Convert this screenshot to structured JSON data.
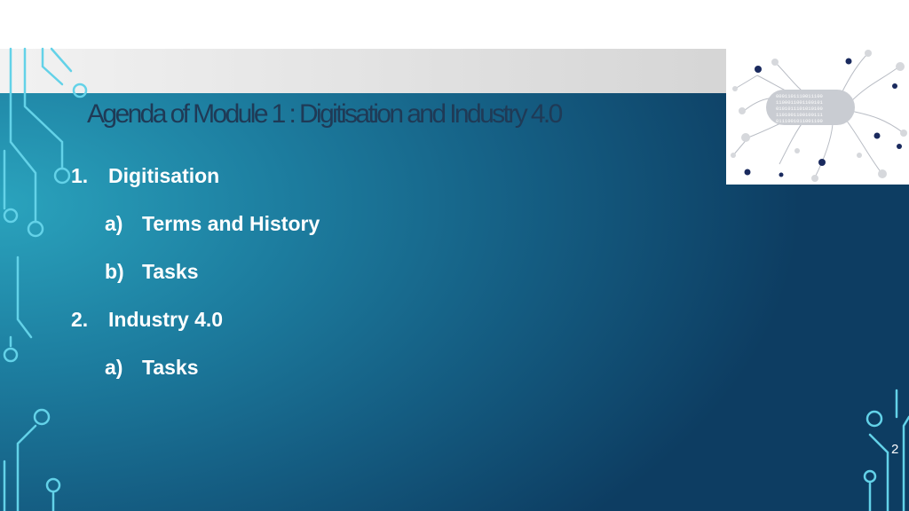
{
  "slide": {
    "title": "Agenda of Module 1 : Digitisation and Industry 4.0",
    "page_number": "2"
  },
  "agenda": [
    {
      "marker": "1.",
      "text": "Digitisation",
      "level": 1
    },
    {
      "marker": "a)",
      "text": "Terms and History",
      "level": 2
    },
    {
      "marker": "b)",
      "text": "Tasks",
      "level": 2
    },
    {
      "marker": "2.",
      "text": "Industry 4.0",
      "level": 1
    },
    {
      "marker": "a)",
      "text": "Tasks",
      "level": 2
    }
  ],
  "thumbnail": {
    "binary_lines": [
      "0001101110011100",
      "1100011001100101",
      "0101011101010100",
      "1101001100100111",
      "0111001011001100"
    ]
  },
  "colors": {
    "background_light": "#2aa3bd",
    "background_dark": "#0d3d62",
    "title_text": "#1f3a56",
    "circuit": "#5fd0e6",
    "body_text": "#ffffff"
  }
}
